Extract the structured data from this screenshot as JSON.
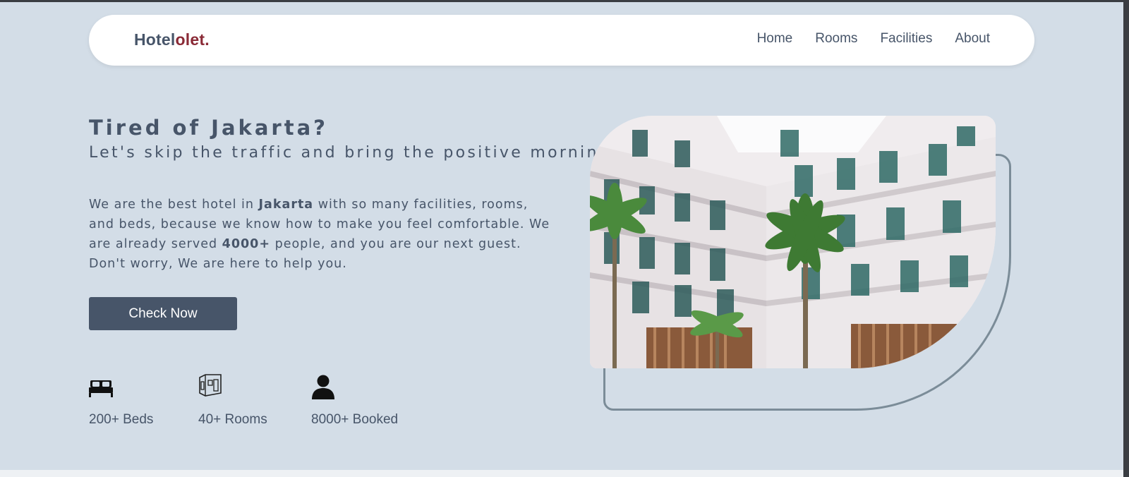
{
  "brand": {
    "name_part1": "Hotel",
    "name_part2": "olet.",
    "accent_color": "#8a2a36"
  },
  "nav": {
    "links": [
      "Home",
      "Rooms",
      "Facilities",
      "About"
    ]
  },
  "hero": {
    "title": "Tired of Jakarta?",
    "subtitle": "Let's skip the traffic and bring the positive morning",
    "description": {
      "p1": "We are the best hotel in ",
      "b1": "Jakarta",
      "p2": " with so many facilities, rooms, and beds, because we know how to make you feel comfortable. We are already served ",
      "b2": "4000+",
      "p3": " people, and you are our next guest. Don't worry, We are here to help you."
    },
    "cta_label": "Check Now"
  },
  "stats": [
    {
      "icon": "bed-icon",
      "label": "200+ Beds"
    },
    {
      "icon": "room-icon",
      "label": "40+ Rooms"
    },
    {
      "icon": "person-icon",
      "label": "8000+ Booked"
    }
  ],
  "colors": {
    "background": "#d3dde7",
    "primary": "#475569",
    "white": "#ffffff"
  }
}
